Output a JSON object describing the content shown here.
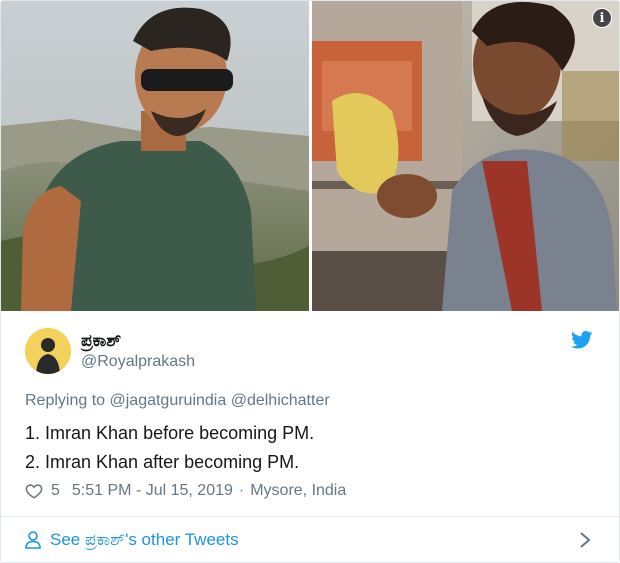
{
  "tweet": {
    "display_name": "ಪ್ರಕಾಶ್",
    "handle": "@Royalprakash",
    "replying_to": "Replying to @jagatguruindia @delhichatter",
    "lines": [
      "1. Imran Khan before becoming PM.",
      "2. Imran Khan after becoming PM."
    ],
    "like_count": "5",
    "timestamp": "5:51 PM - Jul 15, 2019",
    "separator": "·",
    "location": "Mysore, India",
    "see_more": "See ಪ್ರಕಾಶ್'s other Tweets"
  },
  "media": {
    "info_glyph": "i"
  },
  "icons": {
    "info": "info-icon",
    "brand": "twitter-bird-icon",
    "like": "heart-icon",
    "profile": "person-icon",
    "arrow": "chevron-right-icon"
  },
  "colors": {
    "link_blue": "#1b95e0",
    "secondary_text": "#657786",
    "primary_text": "#14171a",
    "border": "#e1e8ed"
  }
}
